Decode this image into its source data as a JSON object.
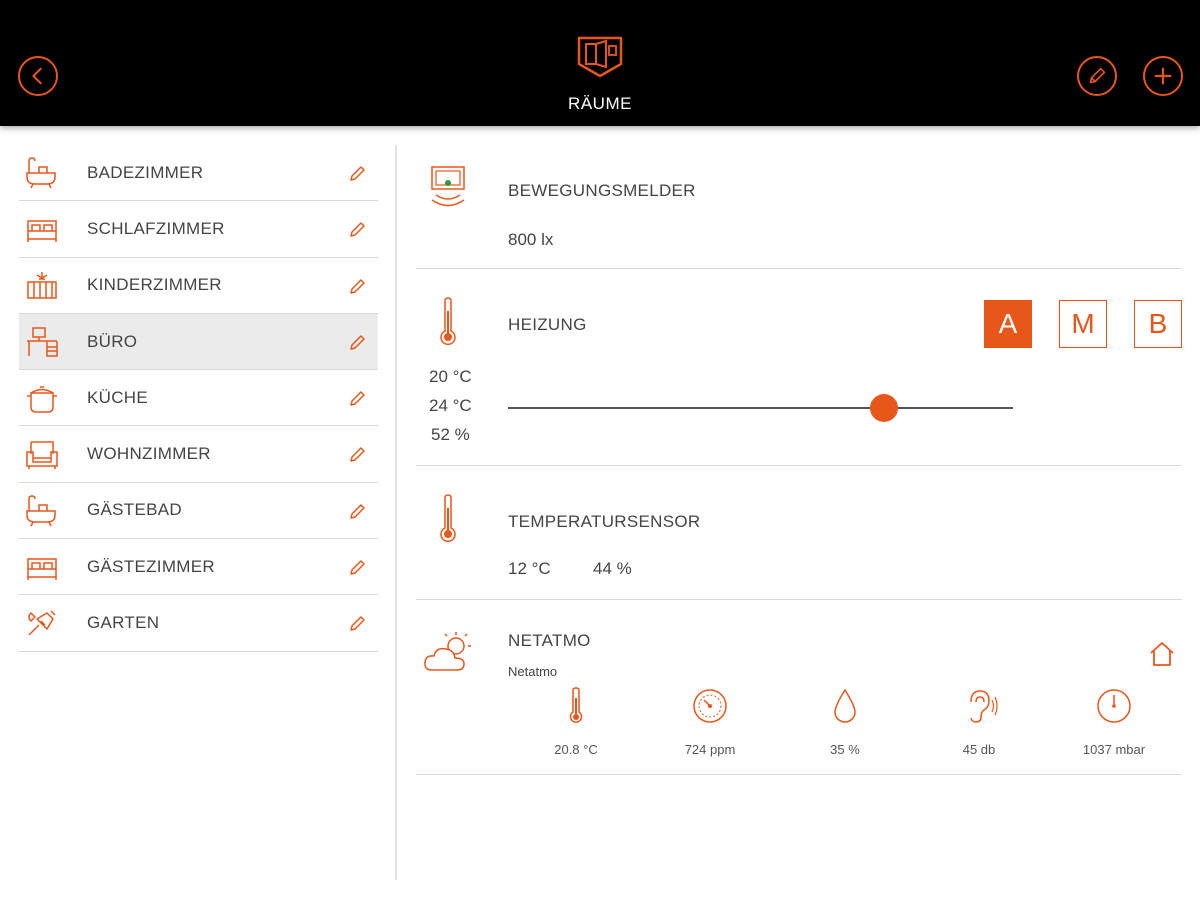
{
  "header": {
    "title": "RÄUME",
    "icons": {
      "back": "back-arrow-icon",
      "logo": "rooms-logo-icon",
      "edit": "pencil-icon",
      "add": "plus-icon"
    }
  },
  "colors": {
    "accent": "#e8571a",
    "header_bg": "#000000",
    "selected_row": "#ebebeb",
    "divider": "#d9d9d9"
  },
  "rooms": [
    {
      "label": "BADEZIMMER",
      "icon": "bathtub-icon"
    },
    {
      "label": "SCHLAFZIMMER",
      "icon": "bed-icon"
    },
    {
      "label": "KINDERZIMMER",
      "icon": "crib-icon"
    },
    {
      "label": "BÜRO",
      "icon": "desk-icon",
      "selected": true
    },
    {
      "label": "KÜCHE",
      "icon": "pot-icon"
    },
    {
      "label": "WOHNZIMMER",
      "icon": "armchair-icon"
    },
    {
      "label": "GÄSTEBAD",
      "icon": "bathtub-icon"
    },
    {
      "label": "GÄSTEZIMMER",
      "icon": "bed-icon"
    },
    {
      "label": "GARTEN",
      "icon": "garden-tools-icon"
    }
  ],
  "devices": {
    "motion": {
      "title": "BEWEGUNGSMELDER",
      "value": "800 lx",
      "icon": "motion-sensor-icon"
    },
    "heating": {
      "title": "HEIZUNG",
      "icon": "thermometer-icon",
      "current_temp": "20 °C",
      "target_temp": "24 °C",
      "valve": "52 %",
      "slider_fraction": 0.745,
      "modes": [
        {
          "label": "A",
          "active": true
        },
        {
          "label": "M",
          "active": false
        },
        {
          "label": "B",
          "active": false
        }
      ]
    },
    "tempsensor": {
      "title": "TEMPERATURSENSOR",
      "icon": "thermometer-icon",
      "temp": "12 °C",
      "humidity": "44 %"
    },
    "netatmo": {
      "title": "NETATMO",
      "subtitle": "Netatmo",
      "icon": "cloud-sun-icon",
      "home_icon": "home-icon",
      "metrics": [
        {
          "value": "20.8 °C",
          "icon": "thermometer-icon"
        },
        {
          "value": "724 ppm",
          "icon": "gauge-icon"
        },
        {
          "value": "35 %",
          "icon": "water-drop-icon"
        },
        {
          "value": "45 db",
          "icon": "ear-icon"
        },
        {
          "value": "1037 mbar",
          "icon": "barometer-icon"
        }
      ]
    }
  }
}
